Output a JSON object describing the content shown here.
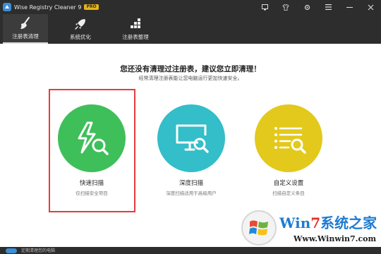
{
  "window": {
    "title": "Wise Registry Cleaner 9",
    "badge": "PRO",
    "controls": [
      "monitor-icon",
      "shirt-icon",
      "settings-icon",
      "menu-icon",
      "minimize-icon",
      "close-icon"
    ]
  },
  "toolbar": {
    "items": [
      {
        "label": "注册表清理",
        "icon": "broom-icon",
        "active": true
      },
      {
        "label": "系统优化",
        "icon": "rocket-icon",
        "active": false
      },
      {
        "label": "注册表整理",
        "icon": "blocks-icon",
        "active": false
      }
    ]
  },
  "main": {
    "headline": "您还没有清理过注册表，建议您立即清理！",
    "subline": "经常清理注册表能让您电脑运行更加快速安全。",
    "cards": [
      {
        "title": "快速扫描",
        "desc": "仅扫描安全项目",
        "color": "#3fbf5a",
        "icon": "lightning-search-icon"
      },
      {
        "title": "深度扫描",
        "desc": "深度扫描适用于高级用户",
        "color": "#33bec9",
        "icon": "monitor-search-icon"
      },
      {
        "title": "自定义设置",
        "desc": "扫描自定义条目",
        "color": "#e3c91c",
        "icon": "list-search-icon"
      }
    ]
  },
  "statusbar": {
    "text": "定期清理您的电脑"
  },
  "watermark": {
    "brand_w": "W",
    "brand_in": "in",
    "brand_7": "7",
    "brand_rest": "系统之家",
    "url": "Www.Winwin7.com"
  },
  "colors": {
    "accent": "#3a8fd6",
    "highlight": "#e53b3b",
    "titlebar": "#2d2d2d"
  }
}
